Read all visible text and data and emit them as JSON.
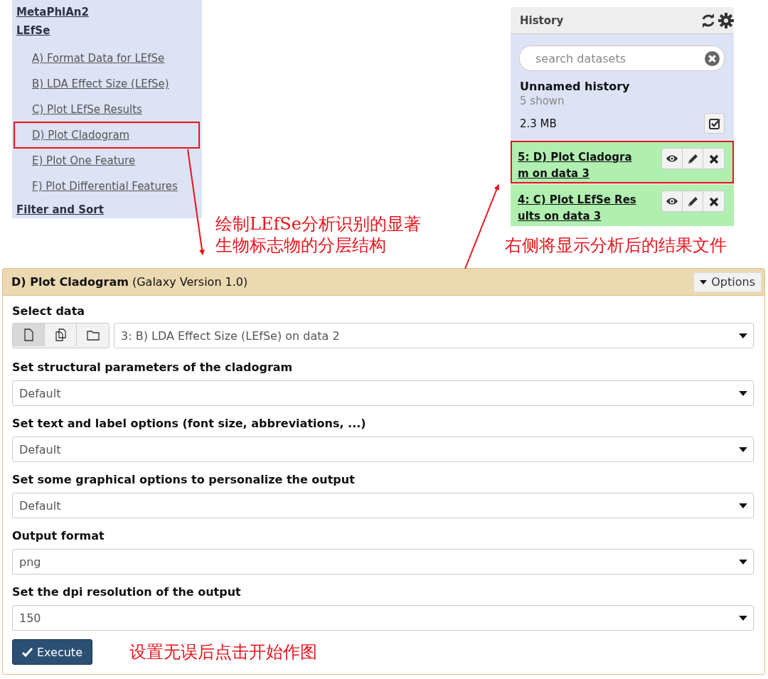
{
  "tool_menu": {
    "sections": [
      {
        "title": "MetaPhlAn2"
      },
      {
        "title": "LEfSe",
        "children": [
          {
            "label": "A) Format Data for LEfSe",
            "highlighted": false
          },
          {
            "label": "B) LDA Effect Size (LEfSe)",
            "highlighted": false
          },
          {
            "label": "C) Plot LEfSe Results",
            "highlighted": false
          },
          {
            "label": "D) Plot Cladogram",
            "highlighted": true
          },
          {
            "label": "E) Plot One Feature",
            "highlighted": false
          },
          {
            "label": "F) Plot Differential Features",
            "highlighted": false
          }
        ]
      },
      {
        "title": "Filter and Sort"
      }
    ]
  },
  "annotations": [
    "绘制LEfSe分析识别的显著生物标志物的分层结构",
    "右侧将显示分析后的结果文件",
    "设置无误后点击开始作图"
  ],
  "history": {
    "title": "History",
    "search": {
      "placeholder": "search datasets"
    },
    "name": "Unnamed history",
    "shown": "5 shown",
    "size": "2.3 MB",
    "datasets": [
      {
        "title": "5: D) Plot Cladogram on data 3",
        "highlighted": true
      },
      {
        "title": "4: C) Plot LEfSe Results on data 3",
        "highlighted": false
      }
    ]
  },
  "tool_form": {
    "title": "D) Plot Cladogram",
    "version": "(Galaxy Version 1.0)",
    "options_button": "Options",
    "fields": [
      {
        "kind": "data",
        "label": "Select data",
        "dataset": "3: B) LDA Effect Size (LEfSe) on data 2",
        "sources": [
          {
            "selected": true
          },
          {
            "selected": false
          },
          {
            "selected": false
          }
        ]
      },
      {
        "kind": "select",
        "label": "Set structural parameters of the cladogram",
        "value": "Default"
      },
      {
        "kind": "select",
        "label": "Set text and label options (font size, abbreviations, ...)",
        "value": "Default"
      },
      {
        "kind": "select",
        "label": "Set some graphical options to personalize the output",
        "value": "Default"
      },
      {
        "kind": "select",
        "label": "Output format",
        "value": "png"
      },
      {
        "kind": "select",
        "label": "Set the dpi resolution of the output",
        "value": "150"
      }
    ],
    "execute_button": "Execute"
  }
}
